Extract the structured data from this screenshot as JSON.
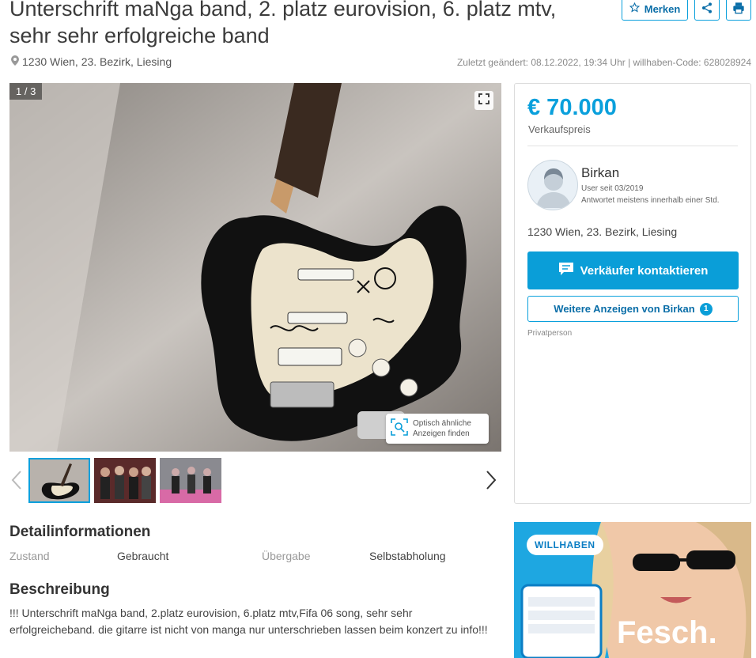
{
  "listing": {
    "title": "Unterschrift maNga band, 2. platz eurovision, 6. platz mtv, sehr sehr erfolgreiche band",
    "location": "1230 Wien, 23. Bezirk, Liesing",
    "meta": "Zuletzt geändert: 08.12.2022, 19:34 Uhr | willhaben-Code: 628028924"
  },
  "actions": {
    "save_label": "Merken",
    "share_icon": "share-icon",
    "print_icon": "print-icon"
  },
  "gallery": {
    "counter": "1 / 3",
    "similar_line1": "Optisch ähnliche",
    "similar_line2": "Anzeigen finden"
  },
  "sidebar": {
    "price": "€ 70.000",
    "price_label": "Verkaufspreis",
    "seller_name": "Birkan",
    "seller_since": "User seit 03/2019",
    "seller_reply": "Antwortet meistens innerhalb einer Std.",
    "location": "1230 Wien, 23. Bezirk, Liesing",
    "contact_label": "Verkäufer kontaktieren",
    "more_label": "Weitere Anzeigen von Birkan",
    "more_count": "1",
    "seller_type": "Privatperson"
  },
  "details": {
    "heading": "Detailinformationen",
    "attrs": [
      {
        "key": "Zustand",
        "value": "Gebraucht"
      },
      {
        "key": "Übergabe",
        "value": "Selbstabholung"
      }
    ]
  },
  "description": {
    "heading": "Beschreibung",
    "text": "!!! Unterschrift maNga band, 2.platz eurovision, 6.platz mtv,Fifa 06 song, sehr sehr erfolgreicheband. die gitarre ist nicht von manga nur unterschrieben lassen beim konzert zu info!!!"
  },
  "ad": {
    "logo_text": "WILLHABEN",
    "headline": "Fesch."
  },
  "colors": {
    "accent": "#0aa0dc",
    "price": "#0aa0dc"
  }
}
